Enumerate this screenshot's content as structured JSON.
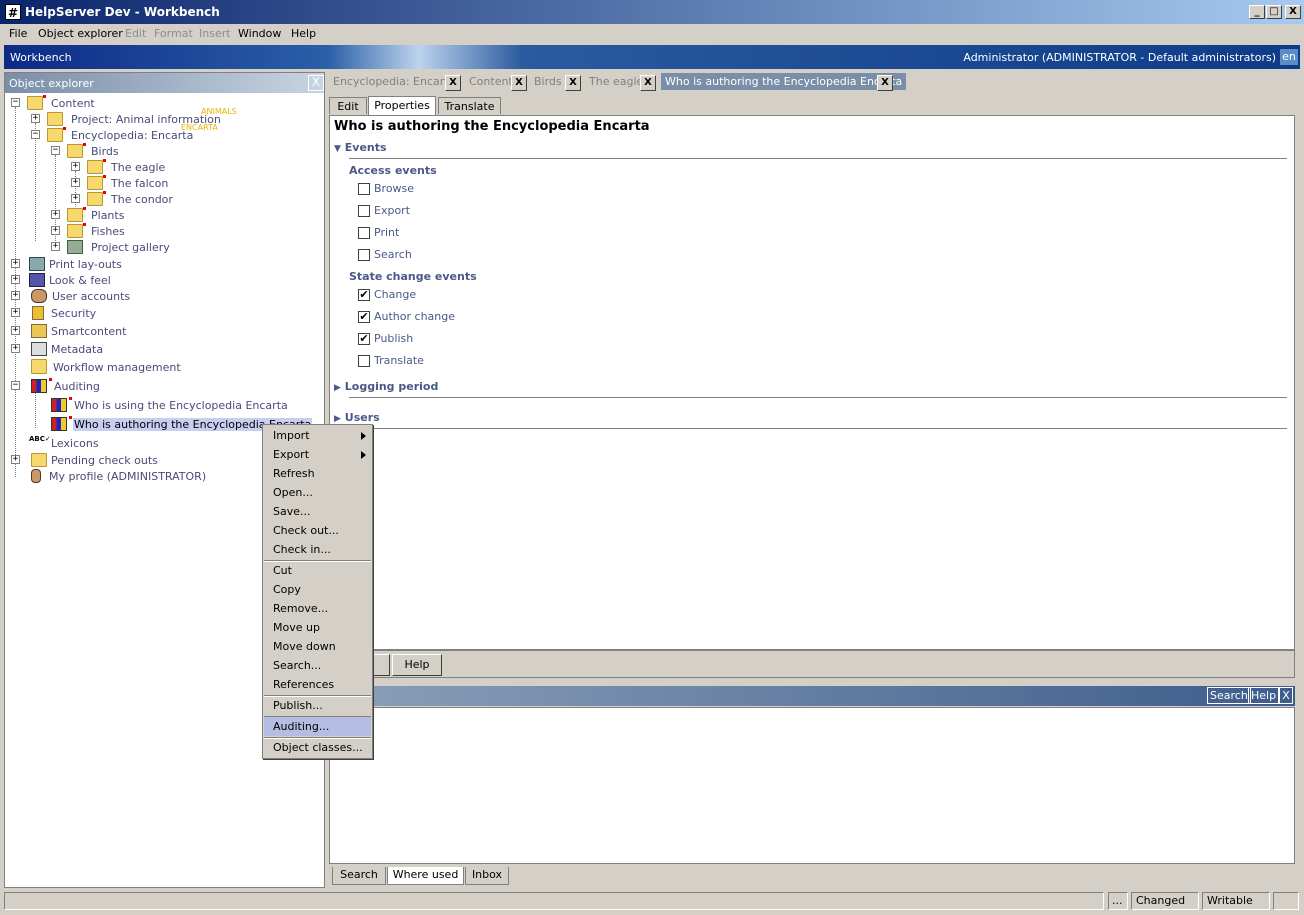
{
  "window": {
    "title": "HelpServer Dev - Workbench",
    "min": "_",
    "max": "□",
    "close": "X"
  },
  "menubar": {
    "items": [
      "File",
      "Object explorer",
      "Edit",
      "Format",
      "Insert",
      "Window",
      "Help"
    ]
  },
  "banner": {
    "label": "Workbench",
    "user": "Administrator (ADMINISTRATOR - Default administrators)",
    "lang": "en"
  },
  "explorer": {
    "title": "Object explorer",
    "nodes": [
      "Content",
      "Project: Animal information",
      "Encyclopedia: Encarta",
      "Birds",
      "The eagle",
      "The falcon",
      "The condor",
      "Plants",
      "Fishes",
      "Project gallery",
      "Print lay-outs",
      "Look & feel",
      "User accounts",
      "Security",
      "Smartcontent",
      "Metadata",
      "Workflow management",
      "Auditing",
      "Who is using the Encyclopedia Encarta",
      "Who is authoring the Encyclopedia Encarta",
      "Lexicons",
      "Pending check outs",
      "My profile (ADMINISTRATOR)"
    ],
    "tags": {
      "animals": "ANIMALS",
      "encarta": "ENCARTA"
    }
  },
  "doc_tabs": [
    "Encyclopedia: Encarta",
    "Content",
    "Birds",
    "The eagle",
    "Who is authoring the Encyclopedia Encarta"
  ],
  "sub_tabs": [
    "Edit",
    "Properties",
    "Translate"
  ],
  "page": {
    "title": "Who is authoring the Encyclopedia Encarta",
    "events_label": "Events",
    "access_label": "Access events",
    "access": [
      {
        "label": "Browse",
        "checked": false
      },
      {
        "label": "Export",
        "checked": false
      },
      {
        "label": "Print",
        "checked": false
      },
      {
        "label": "Search",
        "checked": false
      }
    ],
    "state_label": "State change events",
    "state": [
      {
        "label": "Change",
        "checked": true
      },
      {
        "label": "Author change",
        "checked": true
      },
      {
        "label": "Publish",
        "checked": true
      },
      {
        "label": "Translate",
        "checked": false
      }
    ],
    "logging_label": "Logging period",
    "users_label": "Users",
    "check_mark": "✔"
  },
  "buttons": {
    "help": "Help"
  },
  "lower": {
    "search": "Search",
    "help": "Help",
    "close": "X"
  },
  "bottom_tabs": [
    "Search",
    "Where used",
    "Inbox"
  ],
  "status": {
    "ellipsis": "...",
    "changed": "Changed",
    "writable": "Writable"
  },
  "context_menu": [
    "Import",
    "Export",
    "Refresh",
    "Open...",
    "Save...",
    "Check out...",
    "Check in...",
    "Cut",
    "Copy",
    "Remove...",
    "Move up",
    "Move down",
    "Search...",
    "References",
    "Publish...",
    "Auditing...",
    "Object classes..."
  ],
  "tree_expander": {
    "plus": "+",
    "minus": "−"
  },
  "icons": {
    "folder": "folder-icon",
    "printer": "printer-icon",
    "chart": "chart-icon",
    "lock": "lock-icon",
    "users": "users-icon"
  },
  "colors": {
    "accent": "#0a246a",
    "highlight": "#b5bde3",
    "link": "#4a5a88",
    "tag": "#e8b400"
  }
}
